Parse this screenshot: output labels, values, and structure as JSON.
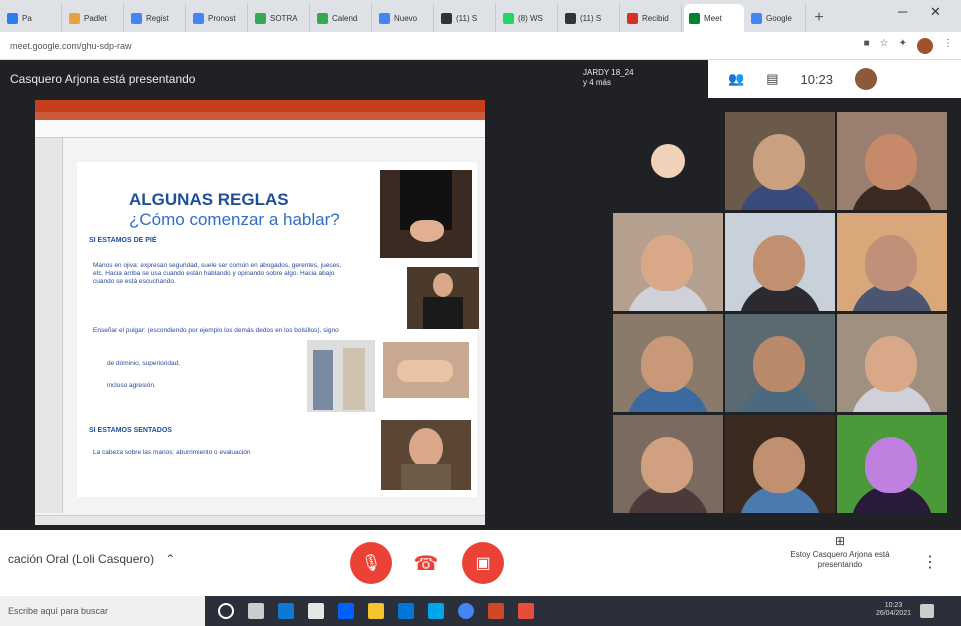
{
  "browser": {
    "tabs": [
      {
        "label": "Pa",
        "color": "#2b7de9"
      },
      {
        "label": "Padlet",
        "color": "#e6a23c"
      },
      {
        "label": "Regist",
        "color": "#4285f4"
      },
      {
        "label": "Pronost",
        "color": "#4285f4"
      },
      {
        "label": "SOTRA",
        "color": "#34a853"
      },
      {
        "label": "Calend",
        "color": "#34a853"
      },
      {
        "label": "Nuevo",
        "color": "#4285f4"
      },
      {
        "label": "(11) S",
        "color": "#333333"
      },
      {
        "label": "(8) WS",
        "color": "#25d366"
      },
      {
        "label": "(11) S",
        "color": "#333333"
      },
      {
        "label": "Recibid",
        "color": "#d93025"
      },
      {
        "label": "Meet",
        "color": "#00832d"
      },
      {
        "label": "Google",
        "color": "#4285f4"
      }
    ],
    "new_tab": "+",
    "url": "meet.google.com/ghu-sdp-raw"
  },
  "meet": {
    "presenting_label": "Casquero Arjona está presentando",
    "pinned_name": "JARDY 18_24",
    "pinned_sub": "y 4 más",
    "clock": "10:23",
    "meeting_name": "cación Oral (Loli Casquero)",
    "presenter_info": "Estoy Casquero Arjona está presentando"
  },
  "slide": {
    "title1": "ALGUNAS REGLAS",
    "title2": "¿Cómo comenzar a hablar?",
    "section1": "SI ESTAMOS DE PIÉ",
    "bullet1": "Manos en ojiva: expresan seguridad, suele ser común en abogados, gerentes, jueces, etc. Hacia arriba se usa cuando están hablando y opinando sobre algo. Hacia abajo cuando se está escuchando.",
    "bullet2": "Enseñar el pulgar: (escondiendo por ejemplo los demás dedos en los bolsillos), signo",
    "line_a": "de dominio, superioridad,",
    "line_b": "incluso agresión.",
    "section2": "SI ESTAMOS SENTADOS",
    "bullet3": "La cabeza sobre las manos: aburrimiento o evaluación"
  },
  "taskbar": {
    "search_placeholder": "Escribe aquí para buscar",
    "time": "10:23",
    "date": "26/04/2021"
  },
  "colors": {
    "red_button": "#ea4335",
    "meet_dark": "#202124",
    "slide_blue": "#1f4e9c"
  },
  "icons": [
    "mic-off-icon",
    "hangup-icon",
    "camera-off-icon",
    "present-icon",
    "more-icon",
    "people-icon",
    "chat-icon"
  ]
}
